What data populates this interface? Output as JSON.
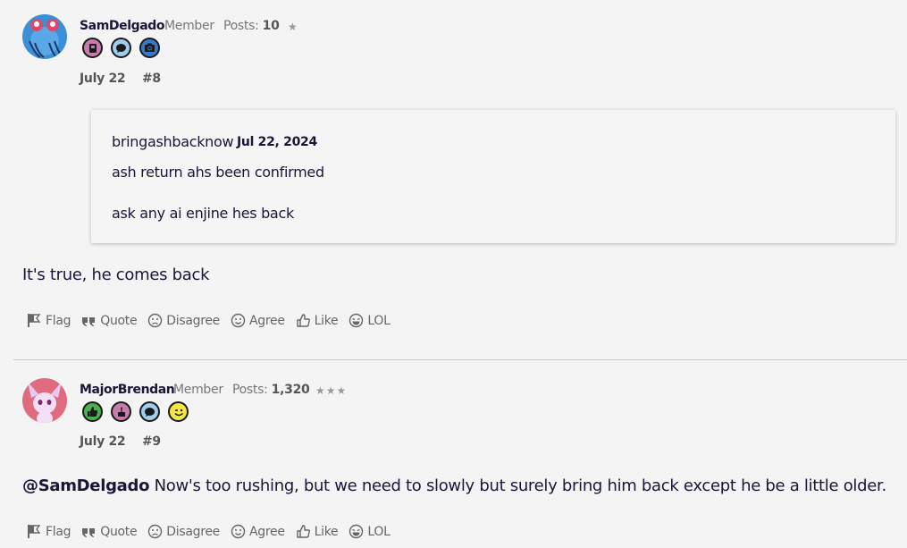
{
  "posts": [
    {
      "username": "SamDelgado",
      "role": "Member",
      "posts_label": "Posts:",
      "posts_count": "10",
      "stars": "★",
      "date": "July 22",
      "post_number": "#8",
      "badges": [
        "book-badge-icon",
        "chat-badge-icon",
        "camera-badge-icon"
      ],
      "quote": {
        "author": "bringashbacknow",
        "date": "Jul 22, 2024",
        "lines": [
          "ash return ahs been confirmed",
          "ask any ai enjine hes back"
        ]
      },
      "body": "It's true, he comes back"
    },
    {
      "username": "MajorBrendan",
      "role": "Member",
      "posts_label": "Posts:",
      "posts_count": "1,320",
      "stars": "★★★",
      "date": "July 22",
      "post_number": "#9",
      "badges": [
        "thumbs-up-badge-icon",
        "cake-badge-icon",
        "chat-badge-icon",
        "wink-badge-icon"
      ],
      "mention": "@SamDelgado",
      "body": " Now's too rushing, but we need to slowly but surely bring him back except he be a little older."
    }
  ],
  "actions": [
    "Flag",
    "Quote",
    "Disagree",
    "Agree",
    "Like",
    "LOL"
  ],
  "colors": {
    "background": "#f4f4f4",
    "text": "#1e1438",
    "muted": "#777777",
    "badge_pink": "#c77dab",
    "badge_blue": "#9fcdf0",
    "badge_camera": "#3a78c9",
    "badge_green": "#4caf50",
    "badge_yellow": "#f5e642"
  }
}
